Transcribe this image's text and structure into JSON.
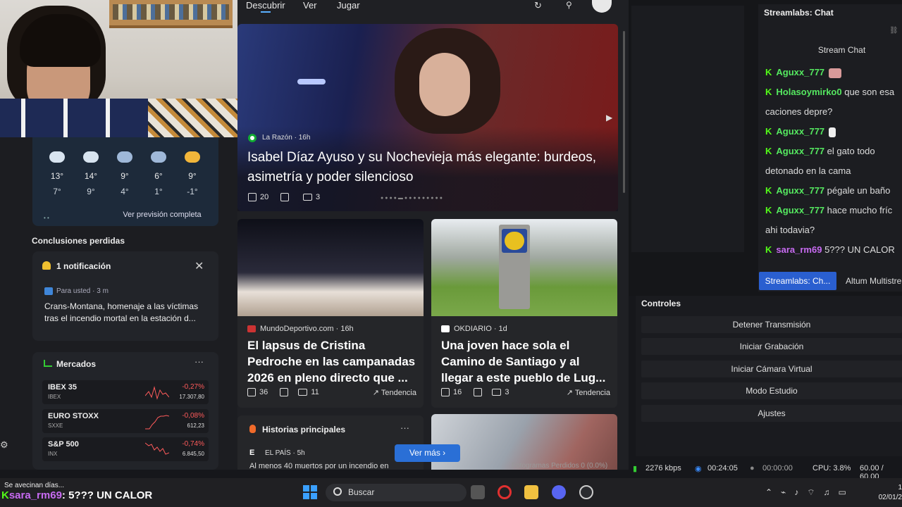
{
  "news": {
    "tabs": [
      "Descubrir",
      "Ver",
      "Jugar"
    ],
    "hero": {
      "source": "La Razón · 16h",
      "title": "Isabel Díaz Ayuso y su Nochevieja más elegante: burdeos, asimetría y poder silencioso",
      "likes": "20",
      "comments": "3"
    },
    "cards": [
      {
        "source": "MundoDeportivo.com · 16h",
        "title": "El lapsus de Cristina Pedroche en las campanadas 2026 en pleno directo que ...",
        "likes": "36",
        "comments": "11",
        "trend": "Tendencia",
        "color": "#c33"
      },
      {
        "source": "OKDIARIO · 1d",
        "title": "Una joven hace sola el Camino de Santiago y al llegar a este pueblo de Lug...",
        "likes": "16",
        "comments": "3",
        "trend": "Tendencia",
        "color": "#fff"
      }
    ],
    "historias": {
      "title": "Historias principales",
      "source": "EL PAÍS · 5h",
      "snippet": "Al menos 40 muertos por un incendio en",
      "ver_mas": "Ver más"
    }
  },
  "weather": {
    "days": [
      {
        "hi": "13°",
        "lo": "7°",
        "icon": "sun-cloud-icon"
      },
      {
        "hi": "14°",
        "lo": "9°",
        "icon": "cloud-icon"
      },
      {
        "hi": "9°",
        "lo": "4°",
        "icon": "rain-icon"
      },
      {
        "hi": "6°",
        "lo": "1°",
        "icon": "rain-icon"
      },
      {
        "hi": "9°",
        "lo": "-1°",
        "icon": "sun-icon"
      }
    ],
    "link": "Ver previsión completa"
  },
  "missed": {
    "title": "Conclusiones perdidas",
    "notif_title": "1 notificación",
    "meta": "Para usted · 3 m",
    "text": "Crans-Montana, homenaje a las víctimas tras el incendio mortal en la estación d..."
  },
  "markets": {
    "title": "Mercados",
    "rows": [
      {
        "name": "IBEX 35",
        "sym": "IBEX",
        "pct": "-0,27%",
        "val": "17.307,80"
      },
      {
        "name": "EURO STOXX",
        "sym": "SXXE",
        "pct": "-0,08%",
        "val": "612,23"
      },
      {
        "name": "S&P 500",
        "sym": "INX",
        "pct": "-0,74%",
        "val": "6.845,50"
      }
    ]
  },
  "chat": {
    "title": "Streamlabs: Chat",
    "subtitle": "Stream Chat",
    "messages": [
      {
        "user": "Aguxx_777",
        "text": ""
      },
      {
        "user": "Holasoymirko0",
        "text": "que son esa"
      },
      {
        "user": "",
        "text": "caciones depre?"
      },
      {
        "user": "Aguxx_777",
        "text": ""
      },
      {
        "user": "Aguxx_777",
        "text": "el gato todo"
      },
      {
        "user": "",
        "text": "detonado en la cama"
      },
      {
        "user": "Aguxx_777",
        "text": "pégale un baño"
      },
      {
        "user": "Aguxx_777",
        "text": "hace mucho fríc"
      },
      {
        "user": "",
        "text": "ahi todavia?"
      },
      {
        "user": "sara_rm69",
        "text": "5??? UN CALOR"
      }
    ],
    "tabs": [
      "Streamlabs: Ch...",
      "Altum Multistre"
    ]
  },
  "controls": {
    "title": "Controles",
    "buttons": [
      "Detener Transmisión",
      "Iniciar Grabación",
      "Iniciar Cámara Virtual",
      "Modo Estudio",
      "Ajustes"
    ]
  },
  "status": {
    "frames": "Fotogramas Perdidos 0 (0.0%)",
    "kbps": "2276 kbps",
    "live": "00:24:05",
    "rec": "00:00:00",
    "cpu": "CPU: 3.8%",
    "fps": "60.00 / 60.00"
  },
  "overlay": {
    "text": "Se avecinan días...",
    "user": "sara_rm69",
    "msg": ": 5??? UN CALOR"
  },
  "taskbar": {
    "search": "Buscar",
    "date": "02/01/2"
  },
  "colors": {
    "accent": "#2a6fd6",
    "live_green": "#53fc18",
    "negative": "#ff5b5b"
  }
}
